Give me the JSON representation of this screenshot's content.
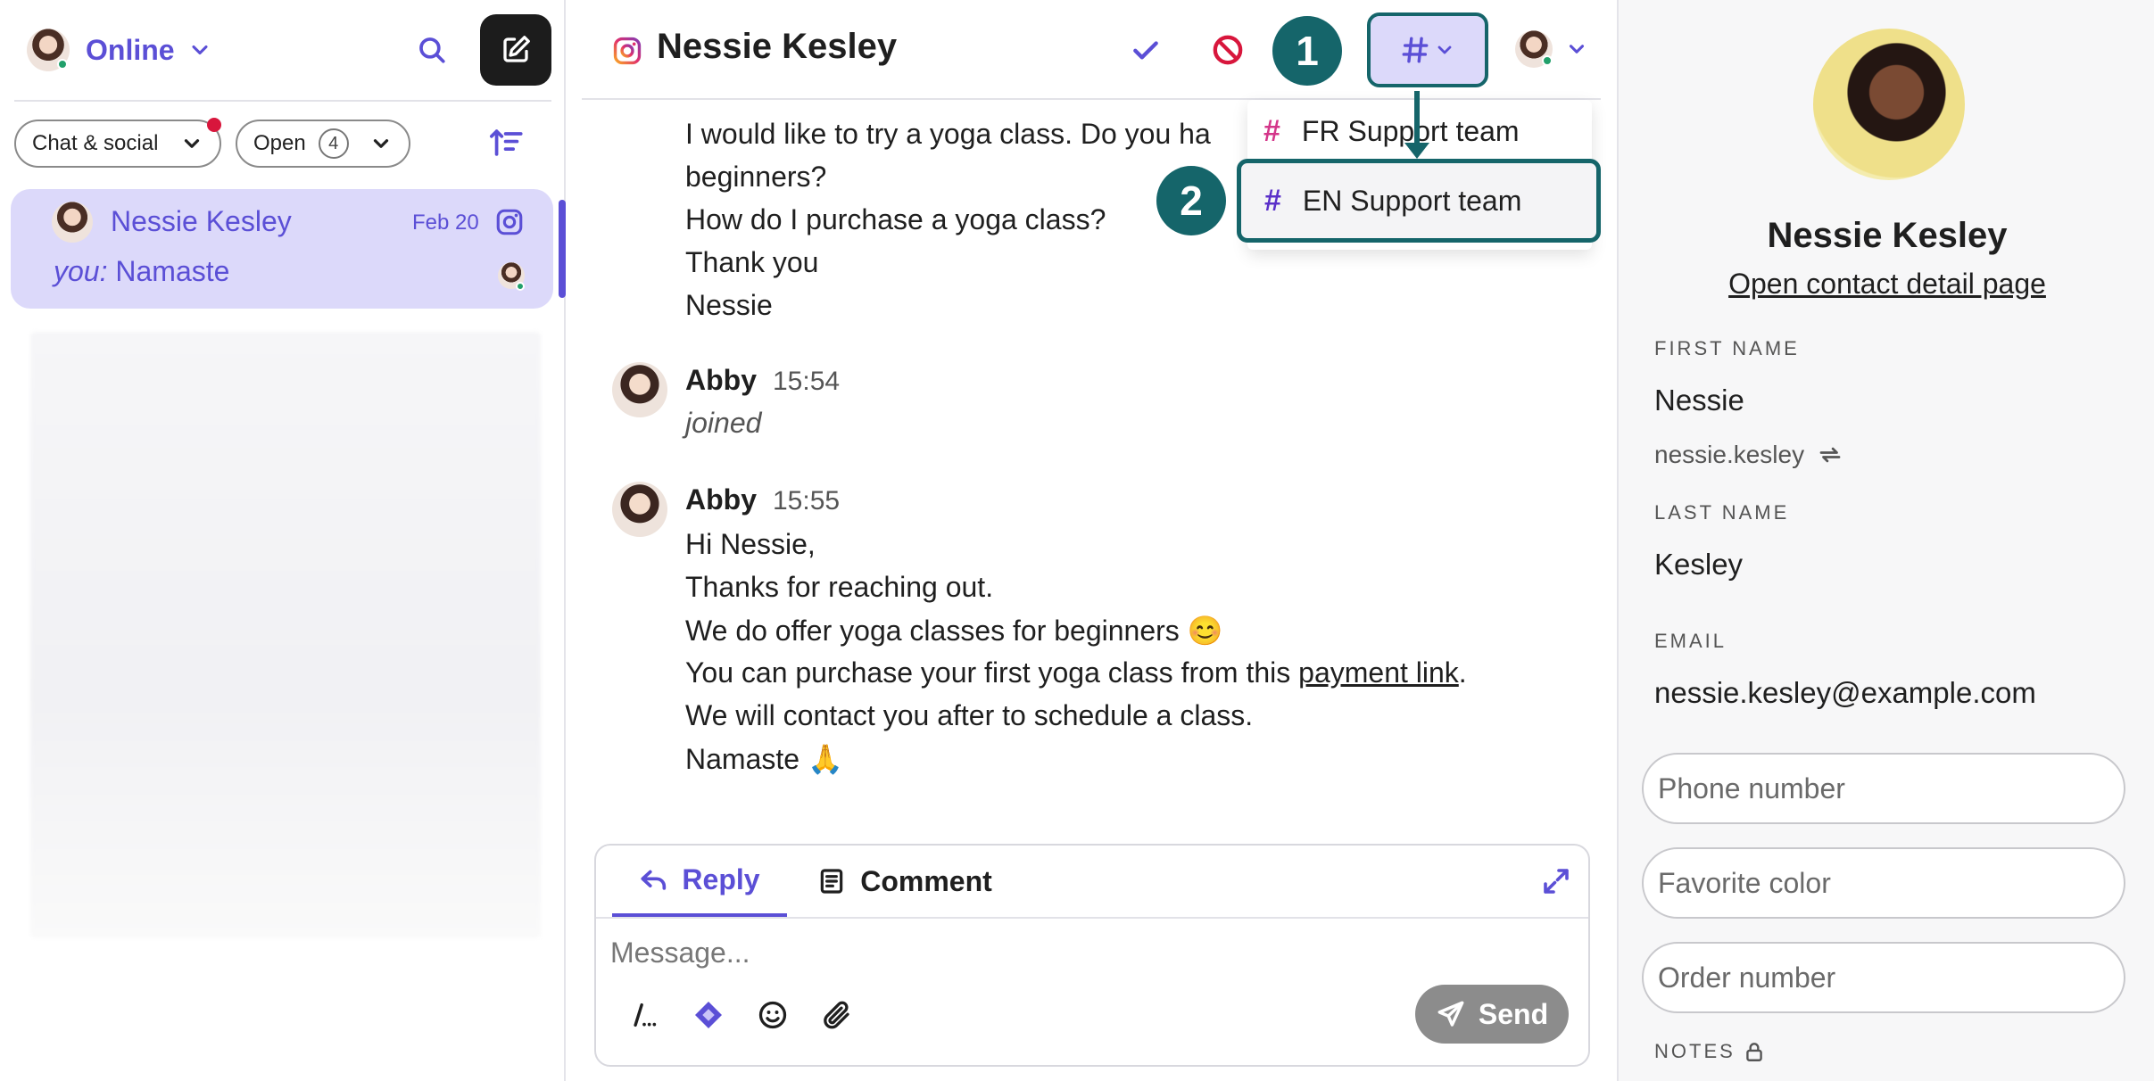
{
  "sidebar": {
    "status_label": "Online",
    "filter_channel": "Chat & social",
    "filter_status": "Open",
    "filter_status_count": "4",
    "conversation": {
      "name": "Nessie Kesley",
      "date": "Feb 20",
      "preview_prefix": "you:",
      "preview_text": "Namaste"
    }
  },
  "header": {
    "title": "Nessie Kesley",
    "team_icon": "hash-icon"
  },
  "annotations": {
    "step1": "1",
    "step2": "2"
  },
  "dropdown": {
    "items": [
      {
        "label": "FR Support team"
      },
      {
        "label": "EN Support team"
      }
    ]
  },
  "messages": {
    "customer_lines": [
      "I would like to try a yoga class. Do you ha",
      "beginners?",
      "How do I purchase a yoga class?",
      "Thank you",
      "Nessie"
    ],
    "join": {
      "author": "Abby",
      "time": "15:54",
      "text": "joined"
    },
    "reply": {
      "author": "Abby",
      "time": "15:55",
      "lines": [
        "Hi Nessie,",
        "Thanks for reaching out.",
        "We do offer yoga classes for beginners 😊"
      ],
      "link_line_prefix": "You can purchase your first yoga class from this ",
      "link_text": "payment link",
      "link_line_suffix": ".",
      "after_lines": [
        "We will contact you after to schedule a class.",
        "Namaste 🙏"
      ]
    }
  },
  "composer": {
    "tab_reply": "Reply",
    "tab_comment": "Comment",
    "placeholder": "Message...",
    "send_label": "Send"
  },
  "contact": {
    "name": "Nessie Kesley",
    "detail_link": "Open contact detail page",
    "first_name_label": "FIRST NAME",
    "first_name": "Nessie",
    "username": "nessie.kesley",
    "last_name_label": "LAST NAME",
    "last_name": "Kesley",
    "email_label": "EMAIL",
    "email": "nessie.kesley@example.com",
    "phone_placeholder": "Phone number",
    "color_placeholder": "Favorite color",
    "order_placeholder": "Order number",
    "notes_label": "NOTES"
  },
  "colors": {
    "accent": "#5b4fd6",
    "selected_bg": "#dcd9fa",
    "annotation": "#15656a",
    "online": "#22a06b",
    "notify": "#d8163c"
  }
}
